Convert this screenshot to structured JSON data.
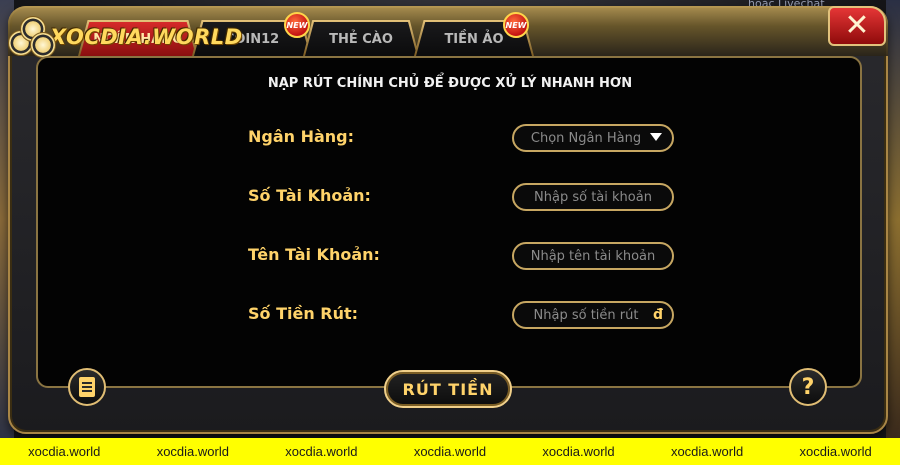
{
  "brand": {
    "logo_text": "XOCDIA.WORLD"
  },
  "header": {
    "corner_text": "hoặc Livechat"
  },
  "tabs": [
    {
      "label": "NGÂN HÀNG",
      "active": true,
      "new": false
    },
    {
      "label": "COIN12",
      "active": false,
      "new": true
    },
    {
      "label": "THẺ CÀO",
      "active": false,
      "new": false
    },
    {
      "label": "TIỀN ẢO",
      "active": false,
      "new": true
    }
  ],
  "new_badge_label": "NEW",
  "close_icon": "close-icon",
  "form": {
    "headline": "NẠP RÚT CHÍNH CHỦ ĐỂ ĐƯỢC XỬ LÝ NHANH HƠN",
    "bank_label": "Ngân Hàng:",
    "bank_select_value": "Chọn Ngân Hàng",
    "account_number_label": "Số Tài Khoản:",
    "account_number_placeholder": "Nhập số tài  khoản",
    "account_name_label": "Tên Tài Khoản:",
    "account_name_placeholder": "Nhập tên tài khoản",
    "amount_label": "Số Tiền Rút:",
    "amount_placeholder": "Nhập số tiền rút",
    "currency_symbol": "đ",
    "submit_label": "RÚT TIỀN",
    "help_label": "?"
  },
  "watermark": [
    "xocdia.world",
    "xocdia.world",
    "xocdia.world",
    "xocdia.world",
    "xocdia.world",
    "xocdia.world",
    "xocdia.world"
  ],
  "colors": {
    "accent_gold": "#ffd36a",
    "tab_active": "#d62a2a",
    "watermark_bg": "#ffff00"
  }
}
